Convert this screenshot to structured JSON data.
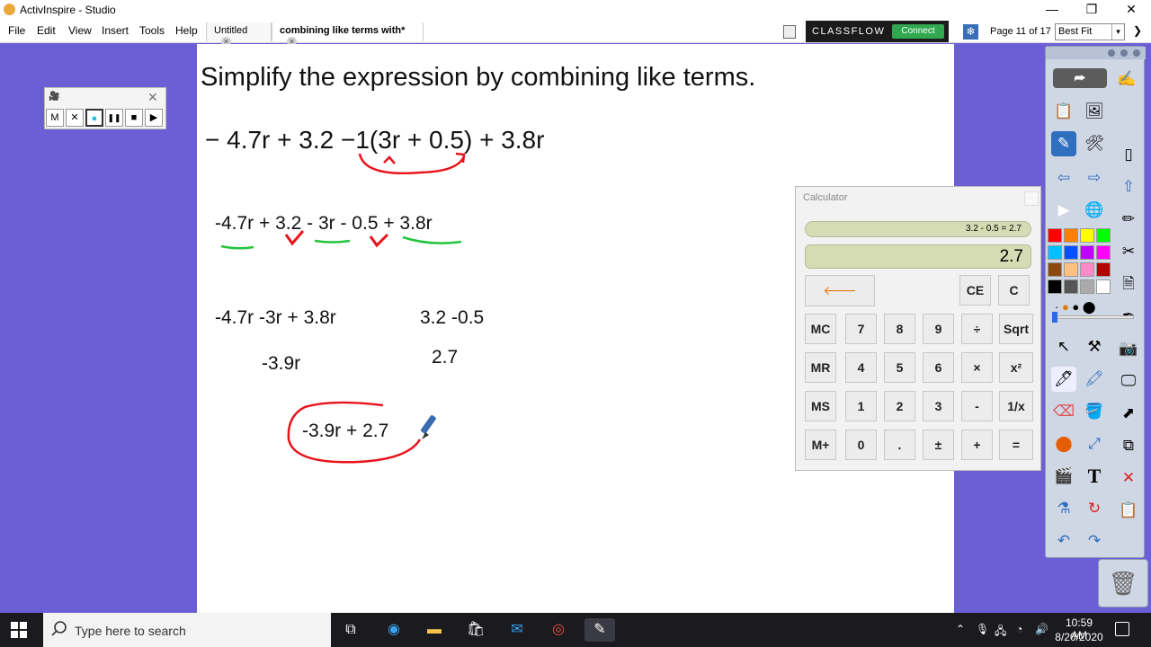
{
  "window": {
    "title": "ActivInspire - Studio",
    "minimize": "—",
    "restore": "❐",
    "close": "✕"
  },
  "menu": [
    "File",
    "Edit",
    "Insert",
    "Tools",
    "Help"
  ],
  "menu_view": "View",
  "tabs": [
    {
      "label": "Untitled",
      "close": "✕"
    },
    {
      "label": "combining like terms with*",
      "close": "✕"
    }
  ],
  "classflow": {
    "logo": "CLASSFLOW",
    "connect": "Connect"
  },
  "page_indicator": "Page 11 of 17",
  "zoom": {
    "value": "Best Fit",
    "arrow": "▾"
  },
  "toolbox_toggle": "❯",
  "canvas": {
    "title": "Simplify the expression by combining like terms.",
    "expression": "− 4.7r + 3.2 −1(3r + 0.5) + 3.8r",
    "step1": "-4.7r + 3.2 - 3r - 0.5 + 3.8r",
    "group_r": "-4.7r -3r + 3.8r",
    "group_const": "3.2 -0.5",
    "result_r": "-3.9r",
    "result_const": "2.7",
    "answer": "-3.9r + 2.7"
  },
  "recorder": {
    "buttons": [
      "M",
      "✕",
      "●",
      "❚❚",
      "■",
      "▶"
    ],
    "close": "✕"
  },
  "calculator": {
    "title": "Calculator",
    "history": "3.2 - 0.5 = 2.7",
    "display": "2.7",
    "back": "🡐",
    "top_keys": [
      "CE",
      "C"
    ],
    "rows": [
      [
        "MC",
        "7",
        "8",
        "9",
        "÷",
        "Sqrt"
      ],
      [
        "MR",
        "4",
        "5",
        "6",
        "×",
        "x²"
      ],
      [
        "MS",
        "1",
        "2",
        "3",
        "-",
        "1/x"
      ],
      [
        "M+",
        "0",
        ".",
        "±",
        "+",
        "="
      ]
    ]
  },
  "palette": [
    "#ff0000",
    "#ff7f00",
    "#ffff00",
    "#00ff00",
    "#00c0ff",
    "#0050ff",
    "#c000ff",
    "#ff00ff",
    "#8b4a10",
    "#ffc080",
    "#ff8ac8",
    "#b00000",
    "#000000",
    "#555555",
    "#aaaaaa",
    "#ffffff"
  ],
  "taskbar": {
    "search_placeholder": "Type here to search",
    "time": "10:59 AM",
    "date": "8/20/2020"
  },
  "colors": {
    "desktop": "#6c5fd6",
    "ink_red": "#e8141c",
    "ink_green": "#23c43a"
  }
}
